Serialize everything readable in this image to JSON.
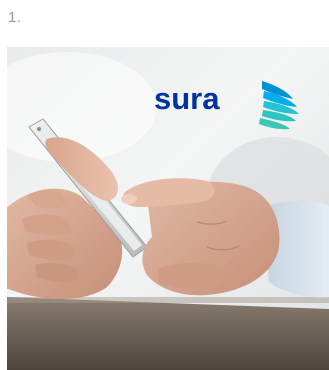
{
  "step": {
    "number": "1."
  },
  "photo": {
    "subject": "hands-holding-smartphone",
    "logo": {
      "text": "sura",
      "color": "#0033a0",
      "accent_colors": [
        "#00aeef",
        "#23c3d3",
        "#3ec7b0"
      ]
    }
  }
}
